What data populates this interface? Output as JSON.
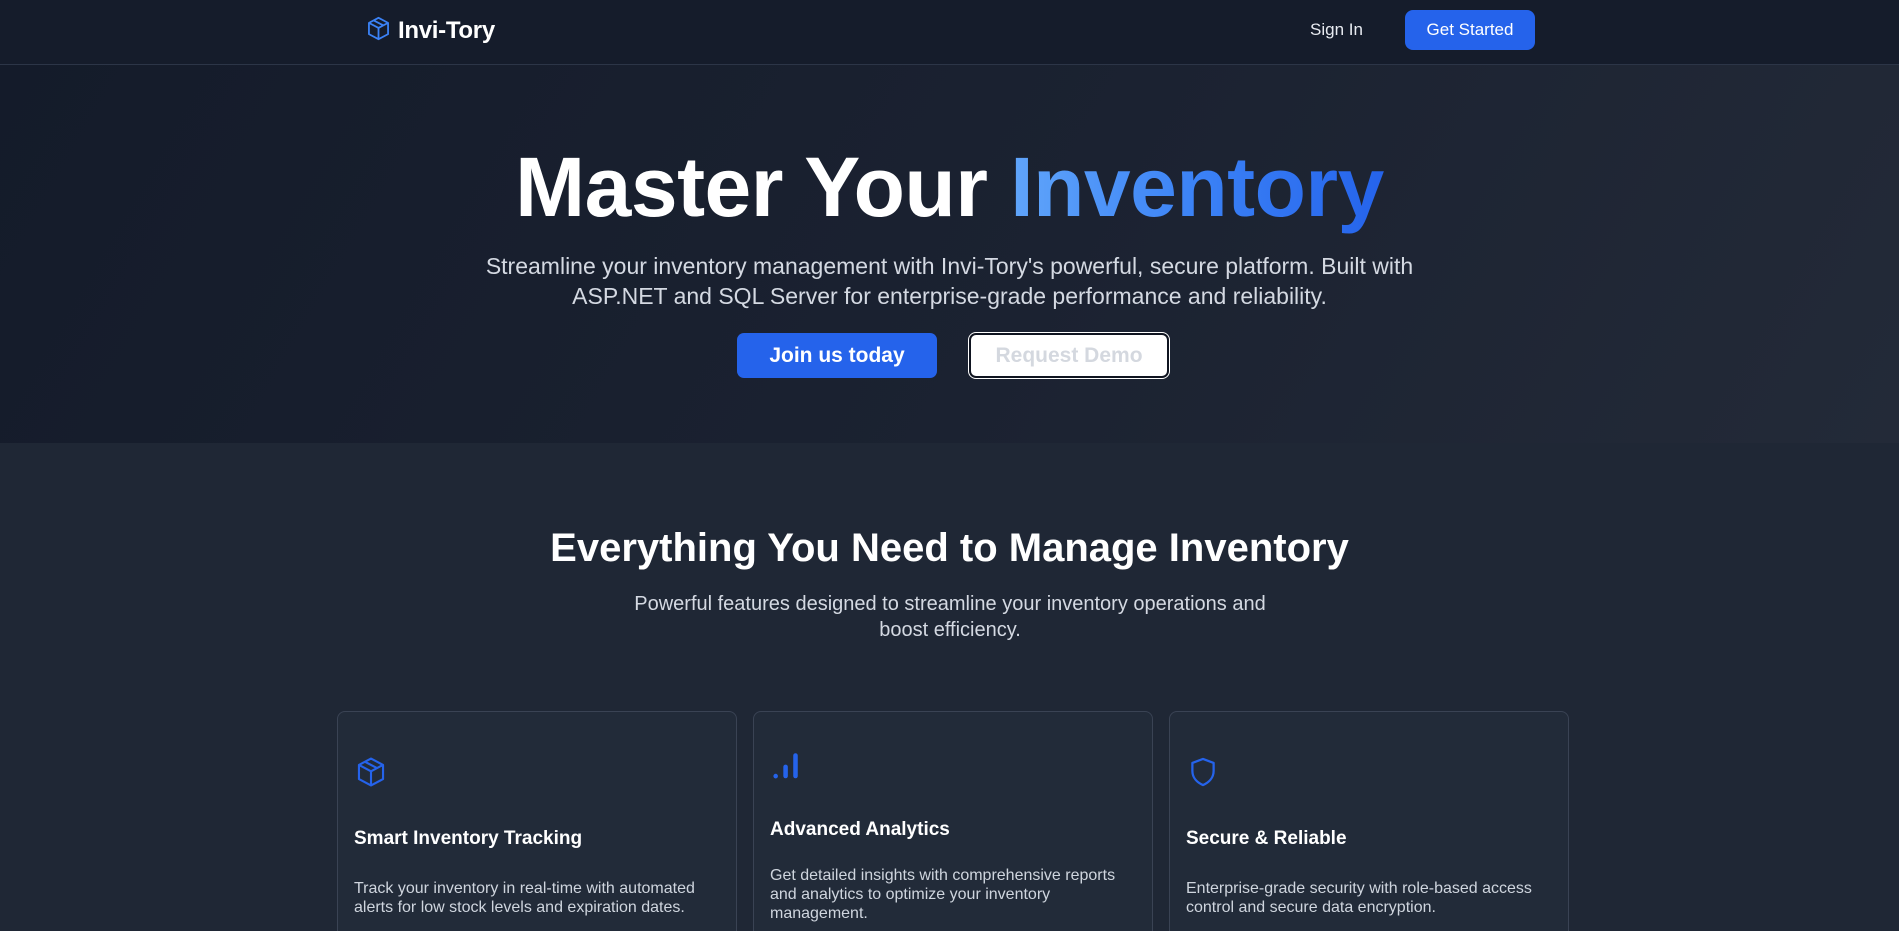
{
  "nav": {
    "brand": "Invi-Tory",
    "brand_icon": "box-icon",
    "sign_in": "Sign In",
    "get_started": "Get Started"
  },
  "hero": {
    "title_main": "Master Your",
    "title_accent": "Inventory",
    "subtitle": "Streamline your inventory management with Invi-Tory's powerful, secure platform. Built with ASP.NET and SQL Server for enterprise-grade performance and reliability.",
    "primary_button": "Join us today",
    "secondary_button": "Request Demo"
  },
  "features": {
    "title": "Everything You Need to Manage Inventory",
    "subtitle": "Powerful features designed to streamline your inventory operations and boost efficiency.",
    "cards": [
      {
        "icon": "box-icon",
        "title": "Smart Inventory Tracking",
        "description": "Track your inventory in real-time with automated alerts for low stock levels and expiration dates."
      },
      {
        "icon": "bar-chart-icon",
        "title": "Advanced Analytics",
        "description": "Get detailed insights with comprehensive reports and analytics to optimize your inventory management."
      },
      {
        "icon": "shield-icon",
        "title": "Secure & Reliable",
        "description": "Enterprise-grade security with role-based access control and secure data encryption."
      }
    ]
  },
  "colors": {
    "accent": "#2563eb",
    "accent_light": "#60a5fa",
    "nav_bg": "#151c2b",
    "page_bg": "#1f2735",
    "card_bg": "#222b39"
  }
}
